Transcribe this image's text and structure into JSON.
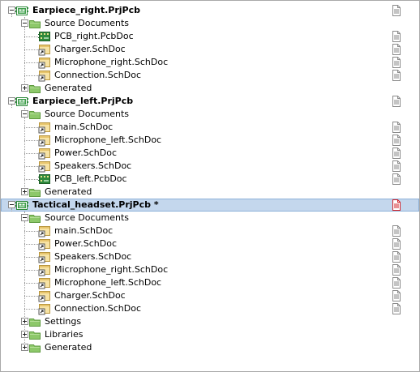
{
  "tree": {
    "projects": [
      {
        "name": "Earpiece_right.PrjPcb",
        "icon": "pcb-project-icon",
        "selected": false,
        "modified": false,
        "folders": [
          {
            "name": "Source Documents",
            "expanded": true,
            "docs": [
              {
                "name": "PCB_right.PcbDoc",
                "type": "pcb"
              },
              {
                "name": "Charger.SchDoc",
                "type": "sch"
              },
              {
                "name": "Microphone_right.SchDoc",
                "type": "sch"
              },
              {
                "name": "Connection.SchDoc",
                "type": "sch"
              }
            ]
          },
          {
            "name": "Generated",
            "expanded": false,
            "docs": []
          }
        ]
      },
      {
        "name": "Earpiece_left.PrjPcb",
        "icon": "pcb-project-icon",
        "selected": false,
        "modified": false,
        "folders": [
          {
            "name": "Source Documents",
            "expanded": true,
            "docs": [
              {
                "name": "main.SchDoc",
                "type": "sch"
              },
              {
                "name": "Microphone_left.SchDoc",
                "type": "sch"
              },
              {
                "name": "Power.SchDoc",
                "type": "sch"
              },
              {
                "name": "Speakers.SchDoc",
                "type": "sch"
              },
              {
                "name": "PCB_left.PcbDoc",
                "type": "pcb"
              }
            ]
          },
          {
            "name": "Generated",
            "expanded": false,
            "docs": []
          }
        ]
      },
      {
        "name": "Tactical_headset.PrjPcb *",
        "icon": "pcb-project-icon",
        "selected": true,
        "modified": true,
        "folders": [
          {
            "name": "Source Documents",
            "expanded": true,
            "docs": [
              {
                "name": "main.SchDoc",
                "type": "sch"
              },
              {
                "name": "Power.SchDoc",
                "type": "sch"
              },
              {
                "name": "Speakers.SchDoc",
                "type": "sch"
              },
              {
                "name": "Microphone_right.SchDoc",
                "type": "sch"
              },
              {
                "name": "Microphone_left.SchDoc",
                "type": "sch"
              },
              {
                "name": "Charger.SchDoc",
                "type": "sch"
              },
              {
                "name": "Connection.SchDoc",
                "type": "sch"
              }
            ]
          },
          {
            "name": "Settings",
            "expanded": false,
            "docs": []
          },
          {
            "name": "Libraries",
            "expanded": false,
            "docs": []
          },
          {
            "name": "Generated",
            "expanded": false,
            "docs": []
          }
        ]
      }
    ]
  },
  "colors": {
    "selection_bg": "#c4d7ed",
    "folder_fill": "#8dc86a",
    "pcb_green": "#2f8a3c",
    "status_modified": "#d2232a",
    "status_normal": "#8a8a8a"
  }
}
